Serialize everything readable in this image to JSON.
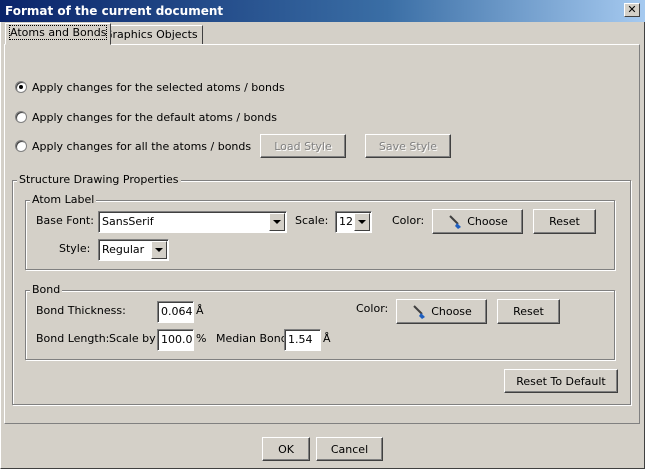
{
  "window": {
    "title": "Format of the current document",
    "close_glyph": "✕"
  },
  "tabs": [
    {
      "label": "Atoms and Bonds",
      "active": true
    },
    {
      "label": "Graphics Objects",
      "active": false
    }
  ],
  "apply_scope": {
    "options": [
      {
        "label": "Apply changes for the selected atoms / bonds",
        "checked": true
      },
      {
        "label": "Apply changes for the default atoms / bonds",
        "checked": false
      },
      {
        "label": "Apply changes for all the atoms / bonds",
        "checked": false
      }
    ],
    "load_style_label": "Load Style",
    "save_style_label": "Save Style"
  },
  "structure": {
    "title": "Structure Drawing Properties",
    "atom_label": {
      "title": "Atom Label",
      "base_font_label": "Base Font:",
      "base_font_value": "SansSerif",
      "scale_label": "Scale:",
      "scale_value": "12",
      "color_label": "Color:",
      "choose_label": "Choose",
      "reset_label": "Reset",
      "style_label": "Style:",
      "style_value": "Regular"
    },
    "bond": {
      "title": "Bond",
      "thickness_label": "Bond Thickness:",
      "thickness_value": "0.064",
      "thickness_unit": "Å",
      "color_label": "Color:",
      "choose_label": "Choose",
      "reset_label": "Reset",
      "length_label": "Bond Length:",
      "scale_by_label": "Scale by",
      "scale_by_value": "100.0",
      "scale_by_unit": "%",
      "median_label": "Median Bond",
      "median_value": "1.54",
      "median_unit": "Å"
    },
    "reset_default_label": "Reset To Default"
  },
  "footer": {
    "ok_label": "OK",
    "cancel_label": "Cancel"
  },
  "colors": {
    "title_bar": "#0a246a",
    "face": "#d4d0c8",
    "brush_handle": "#1f5fbf"
  }
}
